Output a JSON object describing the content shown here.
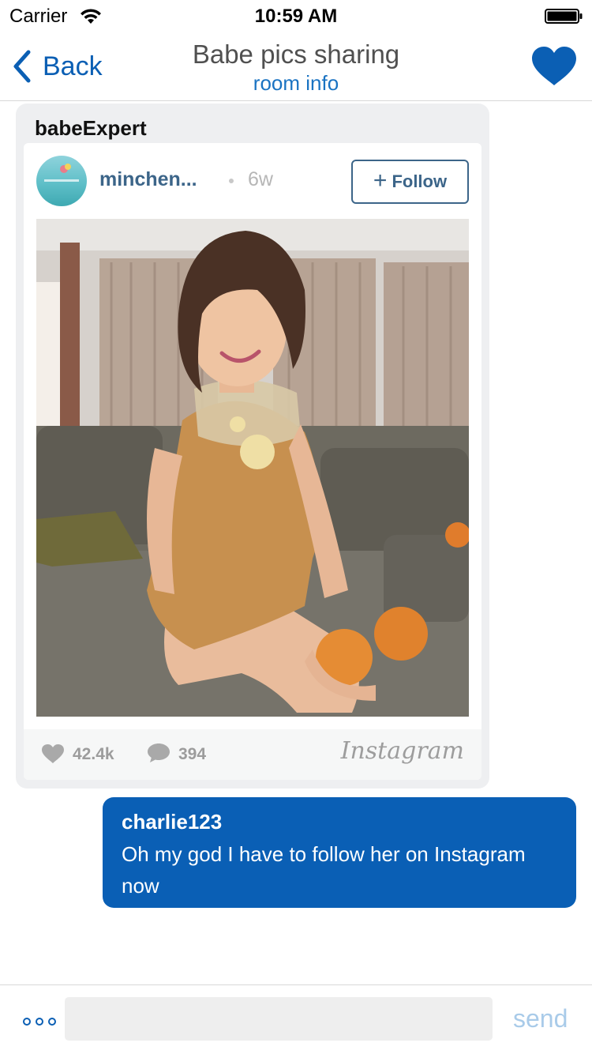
{
  "status_bar": {
    "carrier": "Carrier",
    "time": "10:59 AM"
  },
  "nav": {
    "back_label": "Back",
    "title": "Babe pics sharing",
    "subtitle": "room info",
    "accent_color": "#0b5fb4"
  },
  "shared_post": {
    "sender": "babeExpert",
    "embed": {
      "username": "minchen...",
      "age": "6w",
      "follow_label": "Follow",
      "likes": "42.4k",
      "comments": "394",
      "brand": "Instagram"
    }
  },
  "message": {
    "author": "charlie123",
    "text": "Oh my god I have to follow her on Instagram now",
    "bubble_color": "#0a5fb5"
  },
  "composer": {
    "placeholder": "",
    "send_label": "send"
  },
  "icons": {
    "wifi": "wifi-icon",
    "battery": "battery-icon",
    "back": "chevron-left-icon",
    "favorite": "heart-icon",
    "likes": "heart-icon",
    "comments": "comment-bubble-icon",
    "more": "ellipsis-icon"
  }
}
